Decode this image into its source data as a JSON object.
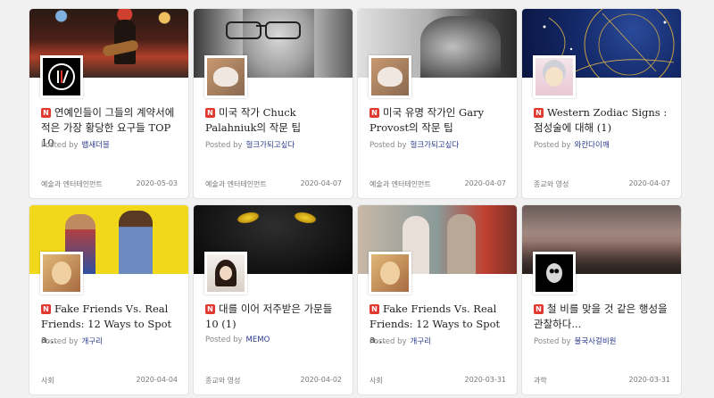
{
  "badge": "N",
  "posted_by_label": "Posted by",
  "cards": [
    {
      "title": "연예인들이 그들의 계약서에 적은 가장 황당한 요구들 TOP 10",
      "author": "뱁새더블",
      "category": "예술과 엔터테인먼트",
      "date": "2020-05-03"
    },
    {
      "title": "미국 작가 Chuck Palahniuk의 작문 팁",
      "author": "헐크가되고싶다",
      "category": "예술과 엔터테인먼트",
      "date": "2020-04-07"
    },
    {
      "title": "미국 유명 작가인 Gary Provost의 작문 팁",
      "author": "헐크가되고싶다",
      "category": "예술과 엔터테인먼트",
      "date": "2020-04-07"
    },
    {
      "title": "Western Zodiac Signs : 점성술에 대해 (1)",
      "author": "와칸다이깨",
      "category": "종교와 영성",
      "date": "2020-04-07"
    },
    {
      "title": "Fake Friends Vs. Real Friends: 12 Ways to Spot a...",
      "author": "개구리",
      "category": "사회",
      "date": "2020-04-04"
    },
    {
      "title": "대를 이어 저주받은 가문들 10 (1)",
      "author": "MEMO",
      "category": "종교와 영성",
      "date": "2020-04-02"
    },
    {
      "title": "Fake Friends Vs. Real Friends: 12 Ways to Spot a...",
      "author": "개구리",
      "category": "사회",
      "date": "2020-03-31"
    },
    {
      "title": "철 비를 맞을 것 같은 행성을 관찰하다...",
      "author": "불국사걸비원",
      "category": "과학",
      "date": "2020-03-31"
    }
  ]
}
